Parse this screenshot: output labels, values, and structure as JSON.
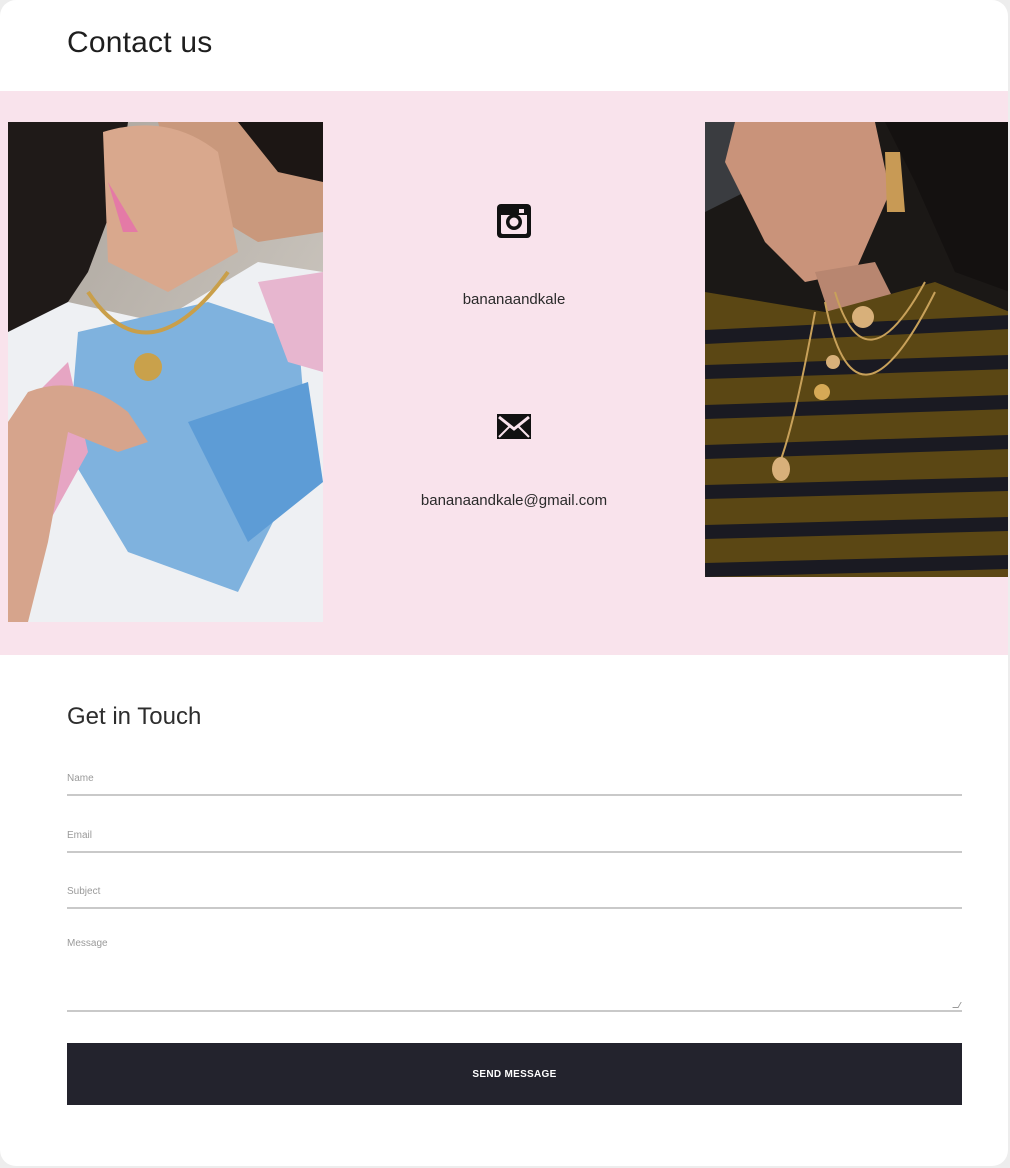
{
  "page": {
    "title": "Contact us"
  },
  "contact": {
    "instagram": {
      "icon": "instagram-icon",
      "handle": "bananaandkale"
    },
    "email": {
      "icon": "envelope-icon",
      "address": "bananaandkale@gmail.com"
    },
    "band_color": "#f9e3ec"
  },
  "form": {
    "title": "Get in Touch",
    "name_placeholder": "Name",
    "email_placeholder": "Email",
    "subject_placeholder": "Subject",
    "message_placeholder": "Message",
    "send_label": "SEND MESSAGE",
    "button_color": "#23232d"
  }
}
